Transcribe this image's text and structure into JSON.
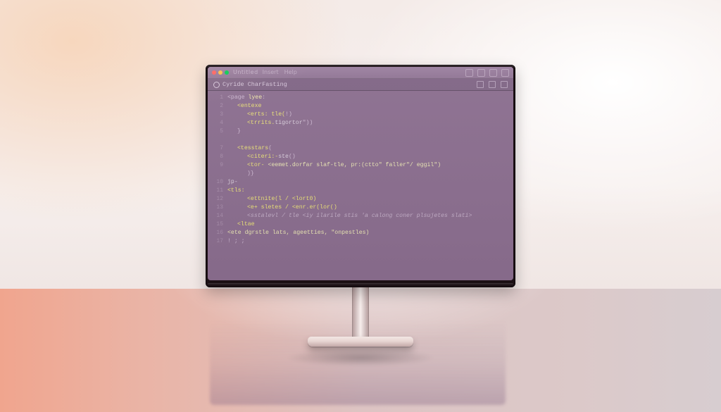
{
  "window": {
    "title": "Untitled",
    "menus": [
      "Insert",
      "Help"
    ]
  },
  "tab": {
    "filename": "Cyride CharFasting"
  },
  "code": {
    "lines": [
      {
        "num": "1",
        "indent": 0,
        "spans": [
          {
            "t": "<page ",
            "c": "punc"
          },
          {
            "t": "lyee",
            "c": "kw"
          },
          {
            "t": ":",
            "c": "punc"
          }
        ]
      },
      {
        "num": "2",
        "indent": 1,
        "spans": [
          {
            "t": "<entexe",
            "c": "tag"
          }
        ]
      },
      {
        "num": "3",
        "indent": 2,
        "spans": [
          {
            "t": "<erts: tle(",
            "c": "tag"
          },
          {
            "t": "!)",
            "c": "punc"
          }
        ]
      },
      {
        "num": "4",
        "indent": 2,
        "spans": [
          {
            "t": "<trrits.",
            "c": "tag"
          },
          {
            "t": "tigortor",
            "c": "attr"
          },
          {
            "t": "\"))",
            "c": "punc"
          }
        ]
      },
      {
        "num": "5",
        "indent": 1,
        "spans": [
          {
            "t": "}",
            "c": "punc"
          }
        ]
      },
      {
        "num": "",
        "indent": 0,
        "spans": []
      },
      {
        "num": "7",
        "indent": 1,
        "spans": [
          {
            "t": "<tesstars",
            "c": "tag"
          },
          {
            "t": "(",
            "c": "punc"
          }
        ]
      },
      {
        "num": "8",
        "indent": 2,
        "spans": [
          {
            "t": "<citeri:-",
            "c": "tag"
          },
          {
            "t": "ste",
            "c": "attr"
          },
          {
            "t": "()",
            "c": "punc"
          }
        ]
      },
      {
        "num": "9",
        "indent": 2,
        "spans": [
          {
            "t": "<tor- ",
            "c": "tag"
          },
          {
            "t": "<eemet.dorfar slaf-tle, pr:(ctto\" faller\"/ eggil\")",
            "c": "str"
          }
        ]
      },
      {
        "num": "",
        "indent": 2,
        "spans": [
          {
            "t": ")}",
            "c": "punc"
          }
        ]
      },
      {
        "num": "10",
        "indent": 0,
        "spans": [
          {
            "t": "jp-",
            "c": "attr"
          }
        ]
      },
      {
        "num": "11",
        "indent": 0,
        "spans": [
          {
            "t": "<tls:",
            "c": "tag"
          }
        ]
      },
      {
        "num": "12",
        "indent": 2,
        "spans": [
          {
            "t": "<ettnite(l / <lort0)",
            "c": "tag"
          }
        ]
      },
      {
        "num": "13",
        "indent": 2,
        "spans": [
          {
            "t": "<e+ sletes / <enr.er(lor()",
            "c": "tag"
          }
        ]
      },
      {
        "num": "14",
        "indent": 2,
        "spans": [
          {
            "t": "<sstalevl / tle <iy ilarile stis 'a calong coner plsujetes slati>",
            "c": "comm"
          }
        ]
      },
      {
        "num": "15",
        "indent": 1,
        "spans": [
          {
            "t": "<ltae",
            "c": "tag"
          }
        ]
      },
      {
        "num": "16",
        "indent": 0,
        "spans": [
          {
            "t": "<ete dgrstle lats, ageetties, \"onpestles)",
            "c": "str"
          }
        ]
      },
      {
        "num": "17",
        "indent": 0,
        "spans": [
          {
            "t": "! ; ;",
            "c": "punc"
          }
        ]
      }
    ]
  }
}
